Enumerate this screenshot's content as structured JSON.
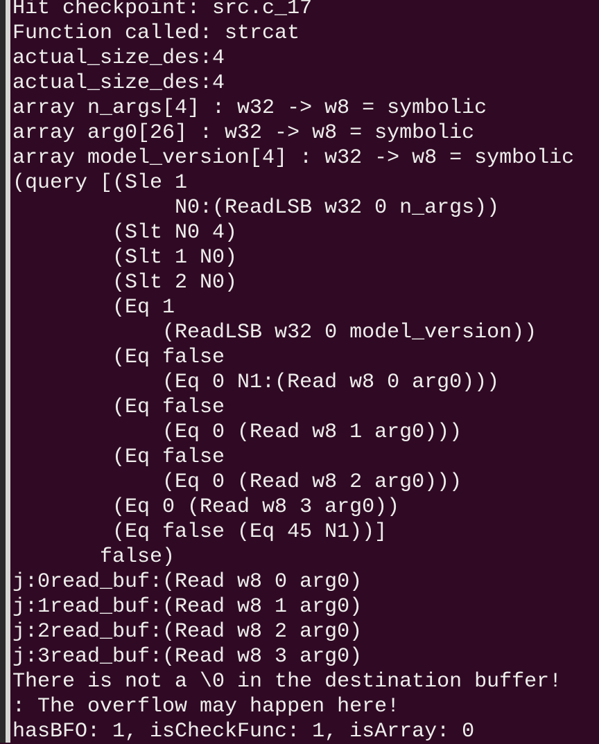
{
  "terminal": {
    "lines": [
      "Hit checkpoint: src.c_17",
      "Function called: strcat",
      "actual_size_des:4",
      "actual_size_des:4",
      "array n_args[4] : w32 -> w8 = symbolic",
      "array arg0[26] : w32 -> w8 = symbolic",
      "array model_version[4] : w32 -> w8 = symbolic",
      "(query [(Sle 1",
      "             N0:(ReadLSB w32 0 n_args))",
      "        (Slt N0 4)",
      "        (Slt 1 N0)",
      "        (Slt 2 N0)",
      "        (Eq 1",
      "            (ReadLSB w32 0 model_version))",
      "        (Eq false",
      "            (Eq 0 N1:(Read w8 0 arg0)))",
      "        (Eq false",
      "            (Eq 0 (Read w8 1 arg0)))",
      "        (Eq false",
      "            (Eq 0 (Read w8 2 arg0)))",
      "        (Eq 0 (Read w8 3 arg0))",
      "        (Eq false (Eq 45 N1))]",
      "       false)",
      "j:0read_buf:(Read w8 0 arg0)",
      "j:1read_buf:(Read w8 1 arg0)",
      "j:2read_buf:(Read w8 2 arg0)",
      "j:3read_buf:(Read w8 3 arg0)",
      "There is not a \\0 in the destination buffer!",
      ": The overflow may happen here!",
      "hasBFO: 1, isCheckFunc: 1, isArray: 0"
    ]
  },
  "colors": {
    "background": "#300a24",
    "text": "#eeeeec"
  }
}
